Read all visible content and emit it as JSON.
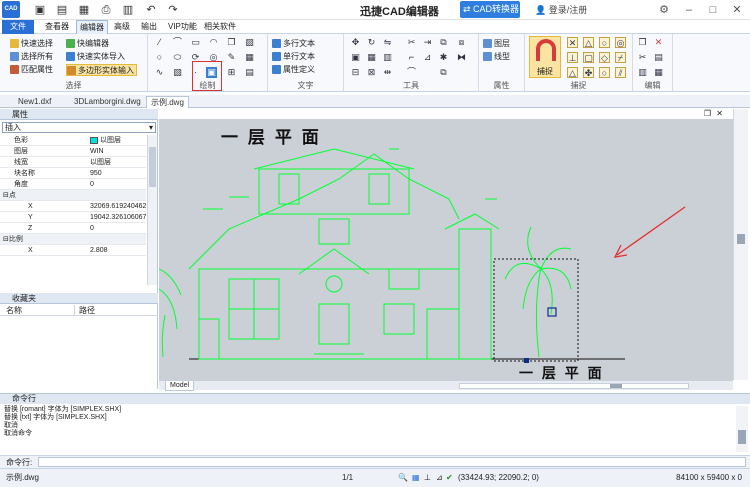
{
  "titlebar": {
    "app_icon": "CAD",
    "title": "迅捷CAD编辑器",
    "convert_label": "CAD转换器",
    "user_label": "登录/注册"
  },
  "menubar": {
    "file": "文件",
    "items": [
      "查看器",
      "编辑器",
      "高级",
      "输出",
      "VIP功能",
      "相关软件"
    ]
  },
  "ribbon": {
    "select": {
      "label": "选择",
      "quick_select": "快速选择",
      "select_all": "选择所有",
      "match_props": "匹配属性",
      "quick_editor": "快编辑器",
      "quick_import": "快速实体导入",
      "poly_input": "多边形实体输入"
    },
    "draw": {
      "label": "绘制"
    },
    "text": {
      "label": "文字",
      "multiline": "多行文本",
      "singleline": "单行文本",
      "attr_def": "属性定义"
    },
    "tools": {
      "label": "工具"
    },
    "props": {
      "label": "属性",
      "layer": "图层",
      "linetype": "线型"
    },
    "snap": {
      "label": "捕捉",
      "snap_btn": "捕捉"
    },
    "edit": {
      "label": "编辑"
    }
  },
  "tabs": [
    "New1.dxf",
    "3DLamborgini.dwg",
    "示例.dwg"
  ],
  "properties": {
    "header": "属性",
    "category": "插入",
    "rows": [
      {
        "k": "色彩",
        "v": "以图层"
      },
      {
        "k": "图层",
        "v": "WIN"
      },
      {
        "k": "线宽",
        "v": "以图层"
      },
      {
        "k": "块名称",
        "v": "950"
      },
      {
        "k": "角度",
        "v": "0"
      }
    ],
    "point_cat": "点",
    "point_rows": [
      {
        "k": "X",
        "v": "32069.619240462"
      },
      {
        "k": "Y",
        "v": "19042.326106067"
      },
      {
        "k": "Z",
        "v": "0"
      }
    ],
    "scale_cat": "比例",
    "scale_rows": [
      {
        "k": "X",
        "v": "2.808"
      }
    ]
  },
  "favorites": {
    "header": "收藏夹",
    "col_name": "名称",
    "col_path": "路径"
  },
  "drawing": {
    "title": "一 层 平 面",
    "bottom_text": "一 层 平 面",
    "model_tab": "Model",
    "accent": "#00ff33",
    "arrow": "#e03030"
  },
  "command": {
    "header": "命令行",
    "log": [
      "替换 [romant] 字体为 [SIMPLEX.SHX]",
      "替换 [txt] 字体为 [SIMPLEX.SHX]",
      "取消",
      "取消命令"
    ],
    "prompt": "命令行:"
  },
  "status": {
    "file": "示例.dwg",
    "page": "1/1",
    "coords": "(33424.93; 22090.2; 0)",
    "size": "84100 x 59400 x 0"
  }
}
